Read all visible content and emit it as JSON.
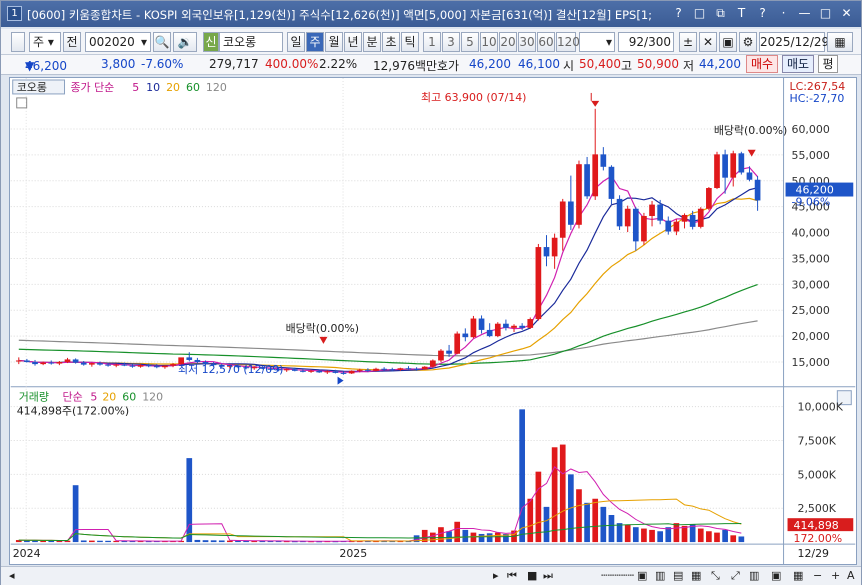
{
  "window": {
    "number": "1",
    "title": "[0600] 키움종합차트 - KOSPI 외국인보유[1,129(천)] 주식수[12,626(천)] 액면[5,000] 자본금[631(억)] 결산[12월] EPS[1;",
    "buttons": [
      "?",
      "□",
      "⧉",
      "T",
      "?",
      "·",
      "—",
      "□",
      "✕"
    ]
  },
  "toolbar": {
    "chart_kind": "주",
    "compare": "전",
    "code": "002020",
    "stock_badge": "신",
    "stock_name": "코오롱",
    "periods": [
      "일",
      "주",
      "월",
      "년",
      "분",
      "초",
      "틱"
    ],
    "selected_period": "주",
    "intervals": [
      "1",
      "3",
      "5",
      "10",
      "20",
      "30",
      "60",
      "120"
    ],
    "count": "92",
    "count_total": "/300",
    "date": "2025/12/29"
  },
  "quote": {
    "price": "46,200",
    "direction": "▼",
    "change": "3,800",
    "change_rate": "-7.60%",
    "volume": "279,717",
    "volume_rate": "400.00%",
    "turnover": "2.22%",
    "amount": "12,976백만",
    "ask_label": "호가",
    "ask": "46,200",
    "bid": "46,100",
    "open_label": "시",
    "open": "50,400",
    "high_label": "고",
    "high": "50,900",
    "low_label": "저",
    "low": "44,200",
    "buy_label": "매수",
    "sell_label": "매도",
    "eval_label": "평"
  },
  "price_panel": {
    "legend": {
      "stock": "코오롱",
      "series": "종가 단순",
      "ma": [
        "5",
        "10",
        "20",
        "60",
        "120"
      ]
    },
    "lc": "LC:267,54",
    "hc": "HC:-27,70",
    "y_ticks": [
      "60,000",
      "55,000",
      "50,000",
      "45,000",
      "40,000",
      "35,000",
      "30,000",
      "25,000",
      "20,000",
      "15,000"
    ],
    "current_price": "46,200",
    "current_rate": "-9.06%",
    "annot_high": "최고 63,900 (07/14)",
    "annot_low": "최저 12,570 (12/09)",
    "annot_div1": "배당락(0.00%)",
    "annot_div2": "배당락(0.00%)"
  },
  "volume_panel": {
    "legend": {
      "name": "거래량",
      "kind": "단순",
      "ma": [
        "5",
        "20",
        "60",
        "120"
      ]
    },
    "value_text": "414,898주(172.00%)",
    "y_ticks": [
      "10,000K",
      "7,500K",
      "5,000K",
      "2,500K"
    ],
    "current": "414,898",
    "current_rate": "172.00%"
  },
  "x_axis": {
    "labels": [
      "2024",
      "2025"
    ],
    "end_label": "12/29"
  },
  "colors": {
    "up": "#e0191b",
    "down": "#1e55c8",
    "ma5": "#d01fb0",
    "ma10": "#1a2a9a",
    "ma20": "#e6a100",
    "ma60": "#17902a",
    "ma120": "#8a8a8a"
  },
  "chart_data": {
    "type": "candlestick",
    "ylim": [
      11000,
      66000
    ],
    "candles": [
      [
        15100,
        15900,
        14600,
        15300
      ],
      [
        15300,
        15600,
        14900,
        15000
      ],
      [
        15000,
        15400,
        14300,
        14600
      ],
      [
        14600,
        15100,
        14400,
        14900
      ],
      [
        14900,
        15300,
        14500,
        14700
      ],
      [
        14700,
        15200,
        14400,
        15000
      ],
      [
        15000,
        15800,
        14800,
        15500
      ],
      [
        15500,
        15700,
        14700,
        14900
      ],
      [
        14900,
        15200,
        14300,
        14500
      ],
      [
        14500,
        14900,
        14100,
        14800
      ],
      [
        14800,
        15100,
        14300,
        14500
      ],
      [
        14500,
        14800,
        14100,
        14300
      ],
      [
        14300,
        14700,
        14000,
        14500
      ],
      [
        14500,
        14900,
        14200,
        14300
      ],
      [
        14300,
        14600,
        13900,
        14100
      ],
      [
        14100,
        14600,
        13900,
        14400
      ],
      [
        14400,
        14700,
        14000,
        14200
      ],
      [
        14200,
        14600,
        13800,
        14000
      ],
      [
        14000,
        14400,
        13700,
        14300
      ],
      [
        14300,
        14800,
        14000,
        14600
      ],
      [
        14600,
        15000,
        14200,
        15900
      ],
      [
        15900,
        16900,
        15100,
        15400
      ],
      [
        15400,
        15800,
        14800,
        15000
      ],
      [
        15000,
        15300,
        14400,
        14600
      ],
      [
        14600,
        15000,
        14200,
        14400
      ],
      [
        14400,
        14700,
        13900,
        14100
      ],
      [
        14100,
        14500,
        13700,
        14300
      ],
      [
        14300,
        14600,
        13800,
        14000
      ],
      [
        14000,
        14400,
        13600,
        13800
      ],
      [
        13800,
        14200,
        13500,
        14000
      ],
      [
        14000,
        14300,
        13600,
        13700
      ],
      [
        13700,
        14000,
        13300,
        13600
      ],
      [
        13600,
        13900,
        13200,
        13400
      ],
      [
        13400,
        13800,
        13100,
        13600
      ],
      [
        13600,
        13900,
        13200,
        13300
      ],
      [
        13300,
        13600,
        13000,
        13200
      ],
      [
        13200,
        13500,
        12900,
        13300
      ],
      [
        13300,
        13600,
        12900,
        13000
      ],
      [
        13000,
        13400,
        12700,
        13200
      ],
      [
        13200,
        13500,
        12800,
        12900
      ],
      [
        12900,
        13200,
        12570,
        12800
      ],
      [
        12800,
        13400,
        12700,
        13300
      ],
      [
        13300,
        13700,
        13000,
        13500
      ],
      [
        13500,
        13800,
        13100,
        13300
      ],
      [
        13300,
        13900,
        13200,
        13700
      ],
      [
        13700,
        14000,
        13300,
        13600
      ],
      [
        13600,
        13900,
        13200,
        13500
      ],
      [
        13500,
        13900,
        13300,
        13800
      ],
      [
        13800,
        14200,
        13500,
        13700
      ],
      [
        13700,
        14000,
        13300,
        13600
      ],
      [
        13600,
        14200,
        13500,
        14100
      ],
      [
        14100,
        15500,
        13900,
        15300
      ],
      [
        15300,
        17500,
        15000,
        17200
      ],
      [
        17200,
        18300,
        16000,
        16600
      ],
      [
        16600,
        20900,
        16500,
        20500
      ],
      [
        20500,
        21500,
        19000,
        19800
      ],
      [
        19800,
        23900,
        19600,
        23400
      ],
      [
        23400,
        24000,
        20500,
        21200
      ],
      [
        21200,
        22500,
        19800,
        20000
      ],
      [
        20000,
        22700,
        19800,
        22400
      ],
      [
        22400,
        23200,
        21100,
        21600
      ],
      [
        21600,
        22300,
        20800,
        22000
      ],
      [
        22000,
        22500,
        21200,
        21600
      ],
      [
        21600,
        23600,
        21400,
        23300
      ],
      [
        23300,
        37800,
        23000,
        37200
      ],
      [
        37200,
        39500,
        33500,
        35400
      ],
      [
        35400,
        39800,
        33000,
        39000
      ],
      [
        39000,
        46500,
        36500,
        46000
      ],
      [
        46000,
        51000,
        40500,
        41500
      ],
      [
        41500,
        53900,
        40800,
        53200
      ],
      [
        53200,
        54600,
        46500,
        47000
      ],
      [
        47000,
        63900,
        46300,
        55100
      ],
      [
        55100,
        56500,
        52000,
        52700
      ],
      [
        52700,
        53000,
        45500,
        46500
      ],
      [
        46500,
        47200,
        40500,
        41200
      ],
      [
        41200,
        45200,
        40100,
        44600
      ],
      [
        44600,
        44900,
        36500,
        38300
      ],
      [
        38300,
        43800,
        37600,
        43200
      ],
      [
        43200,
        46100,
        41200,
        45400
      ],
      [
        45400,
        46300,
        41600,
        42300
      ],
      [
        42300,
        43100,
        39600,
        40200
      ],
      [
        40200,
        42600,
        39500,
        42100
      ],
      [
        42100,
        43700,
        40800,
        43400
      ],
      [
        43400,
        44200,
        40600,
        41100
      ],
      [
        41100,
        44900,
        40800,
        44600
      ],
      [
        44600,
        48800,
        44300,
        48600
      ],
      [
        48600,
        55600,
        48400,
        55100
      ],
      [
        55100,
        56000,
        47500,
        50600
      ],
      [
        50600,
        55800,
        48900,
        55300
      ],
      [
        55300,
        55600,
        51200,
        51600
      ],
      [
        51600,
        52800,
        49900,
        50200
      ],
      [
        50200,
        50900,
        44200,
        46200
      ]
    ],
    "volume_k": [
      150,
      130,
      120,
      110,
      100,
      90,
      105,
      4200,
      120,
      110,
      100,
      95,
      90,
      85,
      80,
      75,
      70,
      75,
      80,
      85,
      90,
      6200,
      160,
      140,
      130,
      120,
      110,
      100,
      95,
      90,
      85,
      80,
      75,
      70,
      65,
      70,
      65,
      60,
      70,
      65,
      80,
      90,
      100,
      95,
      85,
      90,
      80,
      75,
      90,
      500,
      900,
      700,
      1100,
      800,
      1500,
      900,
      700,
      600,
      650,
      700,
      600,
      850,
      9800,
      3200,
      5200,
      2600,
      7000,
      7200,
      5000,
      3900,
      2900,
      3200,
      2600,
      2000,
      1400,
      1300,
      1100,
      1000,
      900,
      800,
      1100,
      1400,
      1200,
      1300,
      1000,
      800,
      700,
      900,
      500,
      415
    ]
  }
}
